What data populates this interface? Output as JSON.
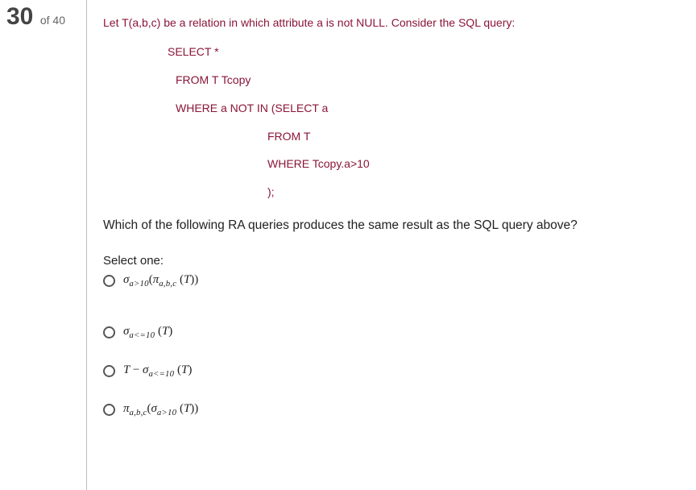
{
  "progress": {
    "current": "30",
    "of_label": "of",
    "total": "40"
  },
  "question": {
    "prompt": "Let T(a,b,c) be a relation in which attribute a is not NULL. Consider the SQL query:",
    "sql": {
      "l1": "SELECT *",
      "l2": "FROM T  Tcopy",
      "l3": "WHERE a NOT IN (SELECT a",
      "l4": "FROM T",
      "l5": "WHERE Tcopy.a>10",
      "l6": ");"
    },
    "followup": "Which of the following RA queries produces the same result as the SQL query above?",
    "select_one_label": "Select one:",
    "options": [
      {
        "id": "opt1",
        "html": "<span class='math'>σ<sub>a&gt;10</sub><span class='op'>(</span>π<sub>a,b,c</sub> <span class='op'>(</span>T<span class='op'>))</span></span>"
      },
      {
        "id": "opt2",
        "html": "<span class='math'>σ<sub>a&lt;=10</sub> <span class='op'>(</span>T<span class='op'>)</span></span>"
      },
      {
        "id": "opt3",
        "html": "<span class='math'>T <span class='op'>−</span> σ<sub>a&lt;=10</sub> <span class='op'>(</span>T<span class='op'>)</span></span>"
      },
      {
        "id": "opt4",
        "html": "<span class='math'>π<sub>a,b,c</sub><span class='op'>(</span>σ<sub>a&gt;10</sub> <span class='op'>(</span>T<span class='op'>))</span></span>"
      }
    ]
  }
}
